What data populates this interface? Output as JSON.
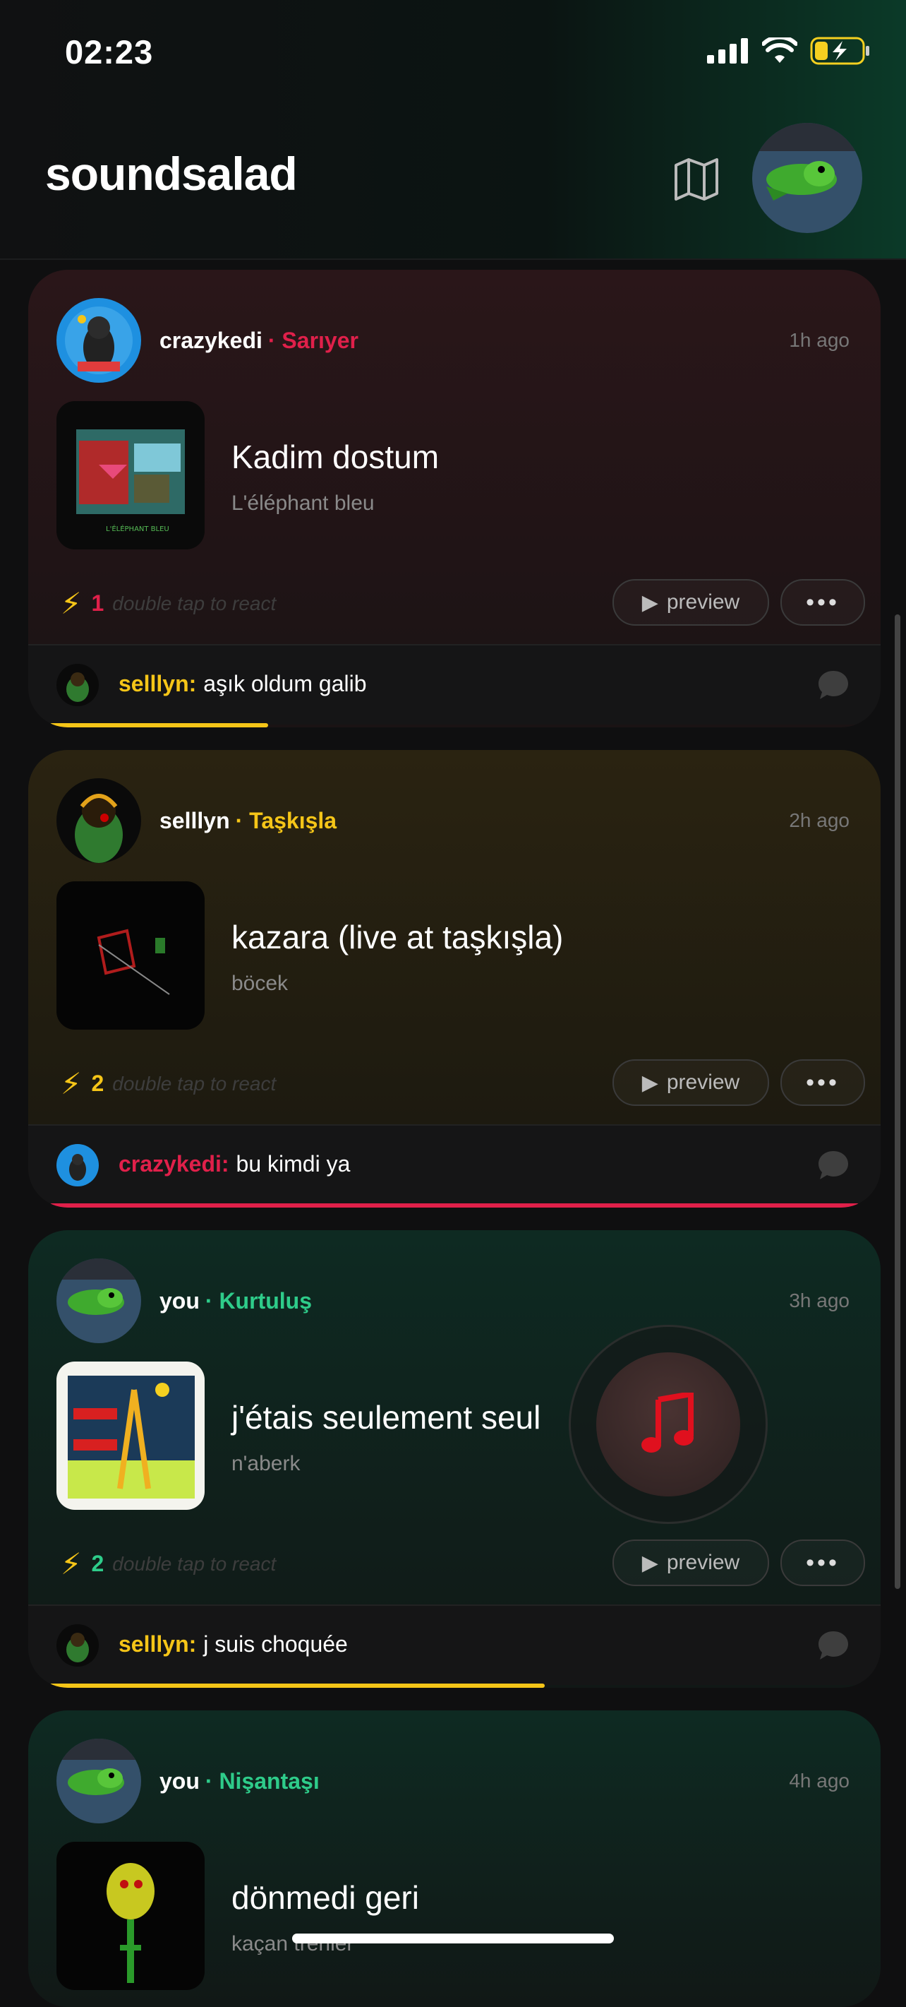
{
  "status": {
    "time": "02:23"
  },
  "app": {
    "title": "soundsalad"
  },
  "colors": {
    "red": "#e0204a",
    "yellow": "#f5c518",
    "green": "#2ecc8a"
  },
  "posts": [
    {
      "user": "crazykedi",
      "location": "· Sarıyer",
      "ago": "1h ago",
      "song": "Kadim dostum",
      "artist": "L'éléphant bleu",
      "reactions": "1",
      "hint": "double tap to react",
      "preview": "preview",
      "comment_user": "selllyn:",
      "comment_text": "aşık oldum galib",
      "progress": 0.27
    },
    {
      "user": "selllyn",
      "location": "· Taşkışla",
      "ago": "2h ago",
      "song": "kazara (live at taşkışla)",
      "artist": "böcek",
      "reactions": "2",
      "hint": "double tap to react",
      "preview": "preview",
      "comment_user": "crazykedi:",
      "comment_text": "bu kimdi ya",
      "progress": 1.0
    },
    {
      "user": "you",
      "location": "· Kurtuluş",
      "ago": "3h ago",
      "song": "j'étais seulement seul",
      "artist": "n'aberk",
      "reactions": "2",
      "hint": "double tap to react",
      "preview": "preview",
      "comment_user": "selllyn:",
      "comment_text": "j suis choquée",
      "progress": 0.61
    },
    {
      "user": "you",
      "location": "· Nişantaşı",
      "ago": "4h ago",
      "song": "dönmedi geri",
      "artist": "kaçan trenler"
    }
  ]
}
